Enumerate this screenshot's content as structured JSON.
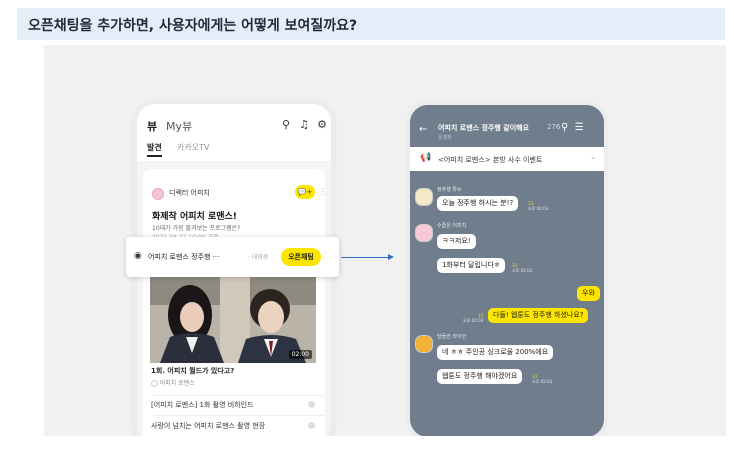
{
  "header": {
    "title": "오픈채팅을 추가하면, 사용자에게는 어떻게 보여질까요?"
  },
  "left_phone": {
    "logo": "뷰",
    "logo_my": "My뷰",
    "icons": [
      "search-icon",
      "music-icon",
      "gear-icon"
    ],
    "tabs": [
      "발견",
      "카카오TV"
    ],
    "card": {
      "channel_name": "디렉터 어피치",
      "badge": "💬+",
      "title": "화제작 어피치 로맨스!",
      "subtitle": "10대가 가장 즐겨보는 프로그램은?",
      "date": "2021.08.27 10:00 기준",
      "video_time": "02:00",
      "caption": "1회. 어피치 월드가 있다고?",
      "caption_source": "어피치 로맨스",
      "list_items": [
        "[어피치 로맨스] 1화 촬영 비하인드",
        "사랑이 넘치는 어피치 로맨스 촬영 현장"
      ]
    },
    "highlight": {
      "text": "어피치 로맨스 정주행 ···",
      "sep": "· 대화중",
      "button": "오픈채팅"
    }
  },
  "right_phone": {
    "title": "어피치 로맨스 정주행 같이해요",
    "member_count": "276",
    "subtitle": "운영자 ·",
    "notice": "<어피치 로맨스> 본방 사수 이벤트",
    "messages": [
      {
        "nick": "정주행 튜브",
        "text": "오늘 정주행 하시는 분!?",
        "count": "13",
        "time": "오후 02:03",
        "side": "left"
      },
      {
        "nick": "수줍은 어피치",
        "text": "ㅋㅋ저요!",
        "side": "left"
      },
      {
        "text": "1화부터 달립니다ㅎ",
        "count": "13",
        "time": "오후 02:03",
        "side": "left"
      },
      {
        "text": "우와",
        "side": "right"
      },
      {
        "text": "다들! 웹툰도 정주행 하셨나요?",
        "count": "13",
        "time": "오후 02:03",
        "side": "right"
      },
      {
        "nick": "당돌한 라이언",
        "text": "네 ㅎㅎ 주인공 싱크로율 200%에요",
        "side": "left"
      },
      {
        "text": "웹툰도 정주행 해야겠어요",
        "count": "13",
        "time": "오후 02:03",
        "side": "left"
      }
    ]
  },
  "colors": {
    "kakao_yellow": "#fee500",
    "chat_bg": "#6f7d8c",
    "arrow": "#2e71c4",
    "header_bg": "#e3eef8"
  }
}
